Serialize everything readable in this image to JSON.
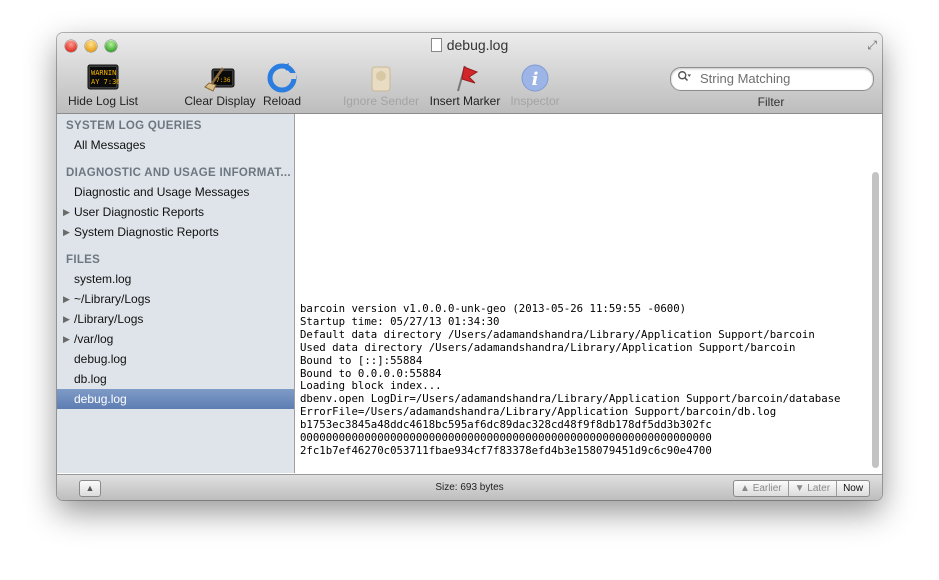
{
  "window": {
    "title": "debug.log"
  },
  "toolbar": {
    "hide_log_list": "Hide Log List",
    "clear_display": "Clear Display",
    "reload": "Reload",
    "ignore_sender": "Ignore Sender",
    "insert_marker": "Insert Marker",
    "inspector": "Inspector",
    "search_placeholder": "String Matching",
    "filter_label": "Filter",
    "console_icon_text": [
      "WARNIN",
      "AY 7:36"
    ]
  },
  "sidebar": {
    "sections": [
      {
        "header": "SYSTEM LOG QUERIES",
        "items": [
          {
            "label": "All Messages",
            "disclosure": false,
            "selected": false
          }
        ]
      },
      {
        "header": "DIAGNOSTIC AND USAGE INFORMAT...",
        "items": [
          {
            "label": "Diagnostic and Usage Messages",
            "disclosure": false,
            "selected": false
          },
          {
            "label": "User Diagnostic Reports",
            "disclosure": true,
            "selected": false
          },
          {
            "label": "System Diagnostic Reports",
            "disclosure": true,
            "selected": false
          }
        ]
      },
      {
        "header": "FILES",
        "items": [
          {
            "label": "system.log",
            "disclosure": false,
            "selected": false
          },
          {
            "label": "~/Library/Logs",
            "disclosure": true,
            "selected": false
          },
          {
            "label": "/Library/Logs",
            "disclosure": true,
            "selected": false
          },
          {
            "label": "/var/log",
            "disclosure": true,
            "selected": false
          },
          {
            "label": "debug.log",
            "disclosure": false,
            "selected": false
          },
          {
            "label": "db.log",
            "disclosure": false,
            "selected": false
          },
          {
            "label": "debug.log",
            "disclosure": false,
            "selected": true
          }
        ]
      }
    ]
  },
  "log": {
    "lines": [
      "barcoin version v1.0.0.0-unk-geo (2013-05-26 11:59:55 -0600)",
      "Startup time: 05/27/13 01:34:30",
      "Default data directory /Users/adamandshandra/Library/Application Support/barcoin",
      "Used data directory /Users/adamandshandra/Library/Application Support/barcoin",
      "Bound to [::]:55884",
      "Bound to 0.0.0.0:55884",
      "Loading block index...",
      "dbenv.open LogDir=/Users/adamandshandra/Library/Application Support/barcoin/database",
      "ErrorFile=/Users/adamandshandra/Library/Application Support/barcoin/db.log",
      "b1753ec3845a48ddc4618bc595af6dc89dac328cd48f9f8db178df5dd3b302fc",
      "0000000000000000000000000000000000000000000000000000000000000000",
      "2fc1b7ef46270c053711fbae934cf7f83378efd4b3e158079451d9c6c90e4700"
    ]
  },
  "status": {
    "size": "Size: 693 bytes",
    "earlier": "Earlier",
    "later": "Later",
    "now": "Now"
  },
  "colors": {
    "selection": "#5d7db3",
    "sidebar_bg": "#dfe4ea",
    "reload_blue": "#2b7de0"
  }
}
